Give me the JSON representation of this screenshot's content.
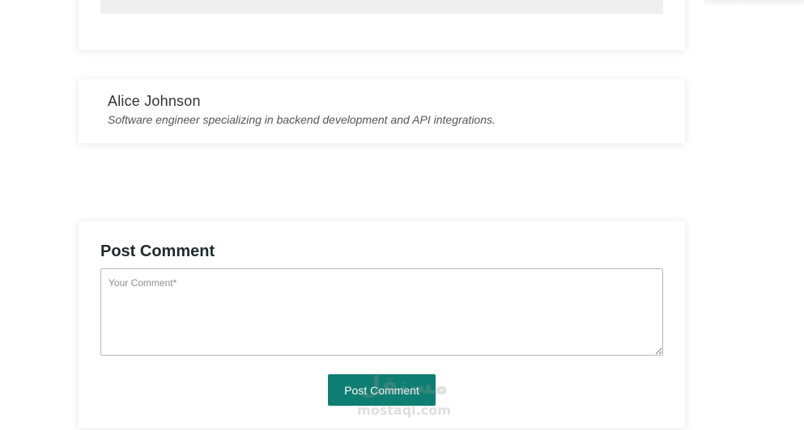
{
  "author": {
    "name": "Alice Johnson",
    "bio": "Software engineer specializing in backend development and API integrations."
  },
  "comment_form": {
    "title": "Post Comment",
    "textarea_placeholder": "Your Comment*",
    "submit_label": "Post Comment"
  },
  "watermark": {
    "brand": "مستقل",
    "url": "mostaql.com"
  },
  "colors": {
    "button_bg": "#0f7e72",
    "button_text": "#ffffff",
    "heading": "#1f2b2b"
  }
}
